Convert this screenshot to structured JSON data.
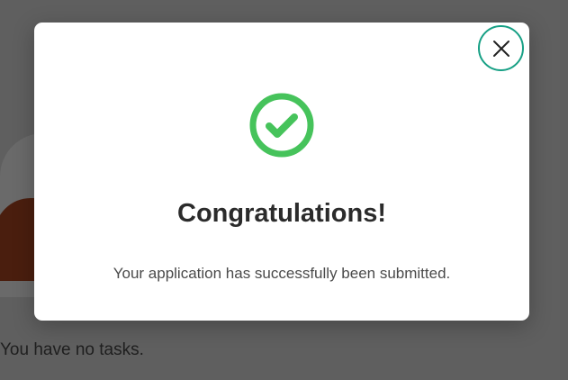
{
  "background": {
    "empty_state_text": "You have no tasks."
  },
  "modal": {
    "title": "Congratulations!",
    "message": "Your application has successfully been submitted.",
    "close_icon": "close-icon",
    "status_icon": "check-circle-icon"
  },
  "colors": {
    "success": "#46c35b",
    "close_border": "#17a085",
    "overlay": "#5f5f5f"
  }
}
